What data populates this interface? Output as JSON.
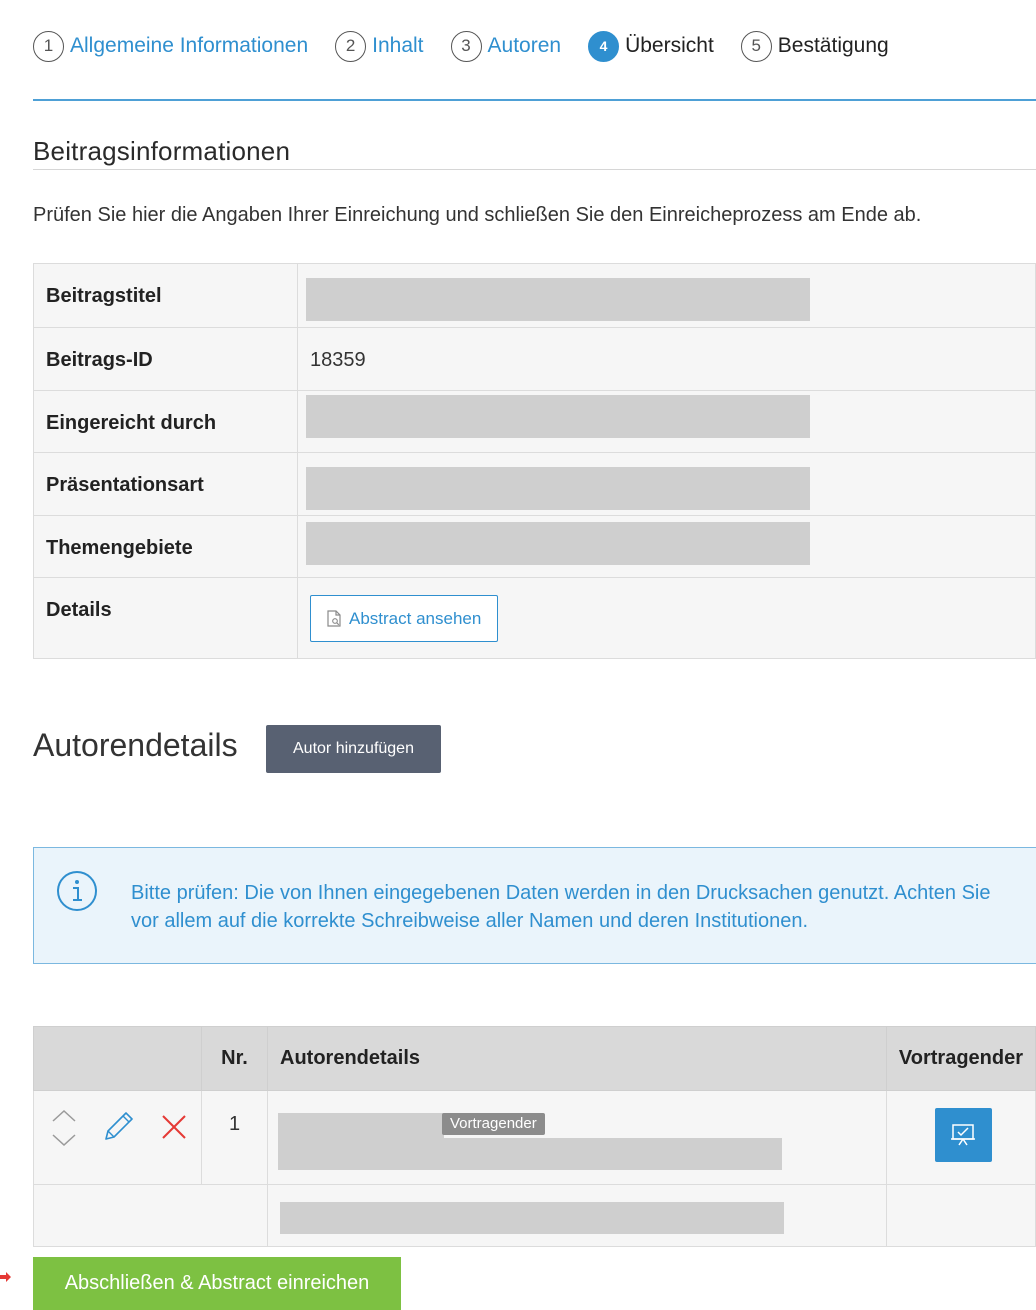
{
  "stepper": {
    "steps": [
      {
        "number": "1",
        "label": "Allgemeine Informationen",
        "state": "done"
      },
      {
        "number": "2",
        "label": "Inhalt",
        "state": "done"
      },
      {
        "number": "3",
        "label": "Autoren",
        "state": "done"
      },
      {
        "number": "4",
        "label": "Übersicht",
        "state": "active"
      },
      {
        "number": "5",
        "label": "Bestätigung",
        "state": "future"
      }
    ]
  },
  "section": {
    "title": "Beitragsinformationen",
    "intro": "Prüfen Sie hier die Angaben Ihrer Einreichung und schließen Sie den Einreicheprozess am Ende ab."
  },
  "info_table": {
    "rows": [
      {
        "label": "Beitragstitel",
        "value": ""
      },
      {
        "label": "Beitrags-ID",
        "value": "18359"
      },
      {
        "label": "Eingereicht durch",
        "value": ""
      },
      {
        "label": "Präsentationsart",
        "value": ""
      },
      {
        "label": "Themengebiete",
        "value": ""
      },
      {
        "label": "Details",
        "button": "Abstract ansehen"
      }
    ]
  },
  "authors": {
    "title": "Autorendetails",
    "add_button": "Autor hinzufügen",
    "alert": "Bitte prüfen: Die von Ihnen eingegebenen Daten werden in den Drucksachen genutzt. Achten Sie vor allem auf die korrekte Schreibweise aller Namen und deren Institutionen.",
    "table": {
      "headers": {
        "actions": "",
        "nr": "Nr.",
        "details": "Autorendetails",
        "presenter": "Vortragender"
      },
      "rows": [
        {
          "nr": "1",
          "badge": "Vortragender"
        }
      ]
    }
  },
  "submit": {
    "label": "Abschließen & Abstract einreichen"
  },
  "colors": {
    "accent": "#2f8fcf",
    "submit": "#7dc142",
    "secondary_button": "#586172",
    "delete": "#e53935",
    "redaction": "#cfcfcf"
  },
  "icons": [
    "reorder-icon",
    "edit-pencil-icon",
    "delete-x-icon",
    "document-search-icon",
    "info-circle-icon",
    "presenter-board-icon"
  ]
}
